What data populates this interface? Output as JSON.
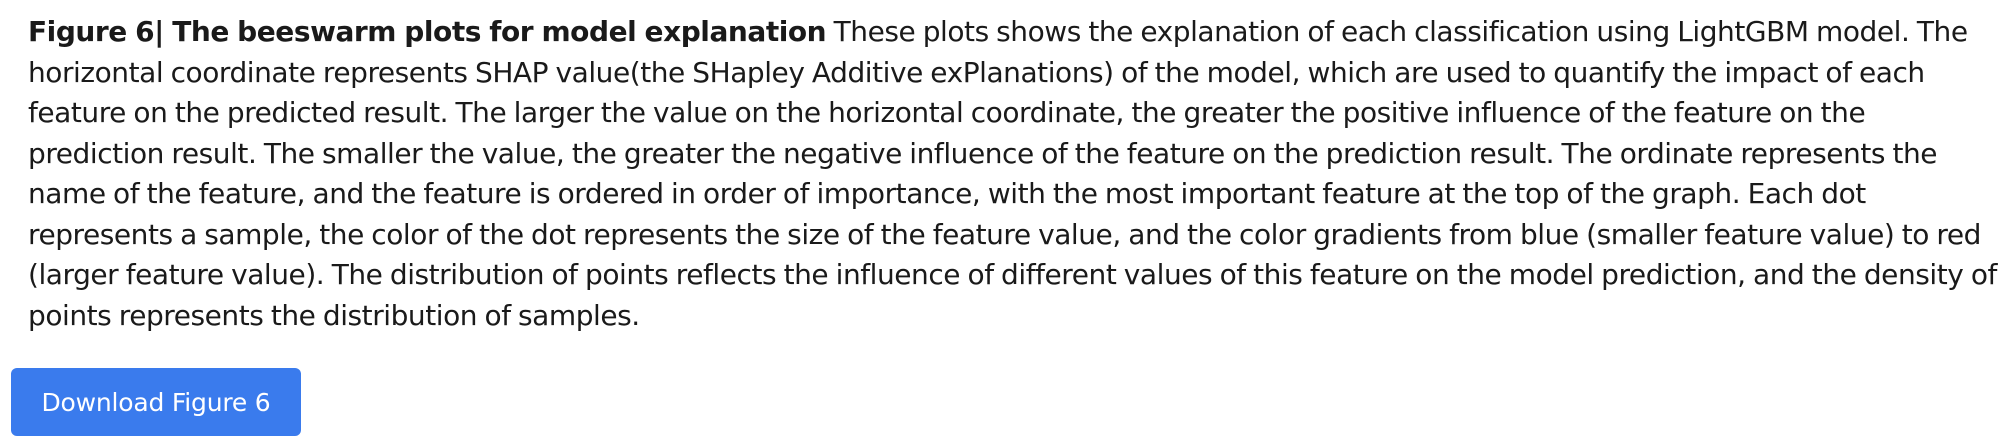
{
  "caption": {
    "title": "Figure 6| The beeswarm plots for model explanation",
    "body": "These plots shows the explanation of each classification using LightGBM model. The horizontal coordinate represents SHAP value(the SHapley Additive exPlanations) of the model, which are used to quantify the impact of each feature on the predicted result. The larger the value on the horizontal coordinate, the greater the positive influence of the feature on the prediction result. The smaller the value, the greater the negative influence of the feature on the prediction result. The ordinate represents the name of the feature, and the feature is ordered in order of importance, with the most important feature at the top of the graph. Each dot represents a sample, the color of the dot represents the size of the feature value, and the color gradients from blue (smaller feature value) to red (larger feature value). The distribution of points reflects the influence of different values of this feature on the model prediction, and the density of points represents the distribution of samples."
  },
  "download": {
    "label": "Download Figure 6"
  },
  "colors": {
    "button_background": "#3a7bed",
    "button_text": "#ffffff",
    "text": "#1a1a1a"
  }
}
